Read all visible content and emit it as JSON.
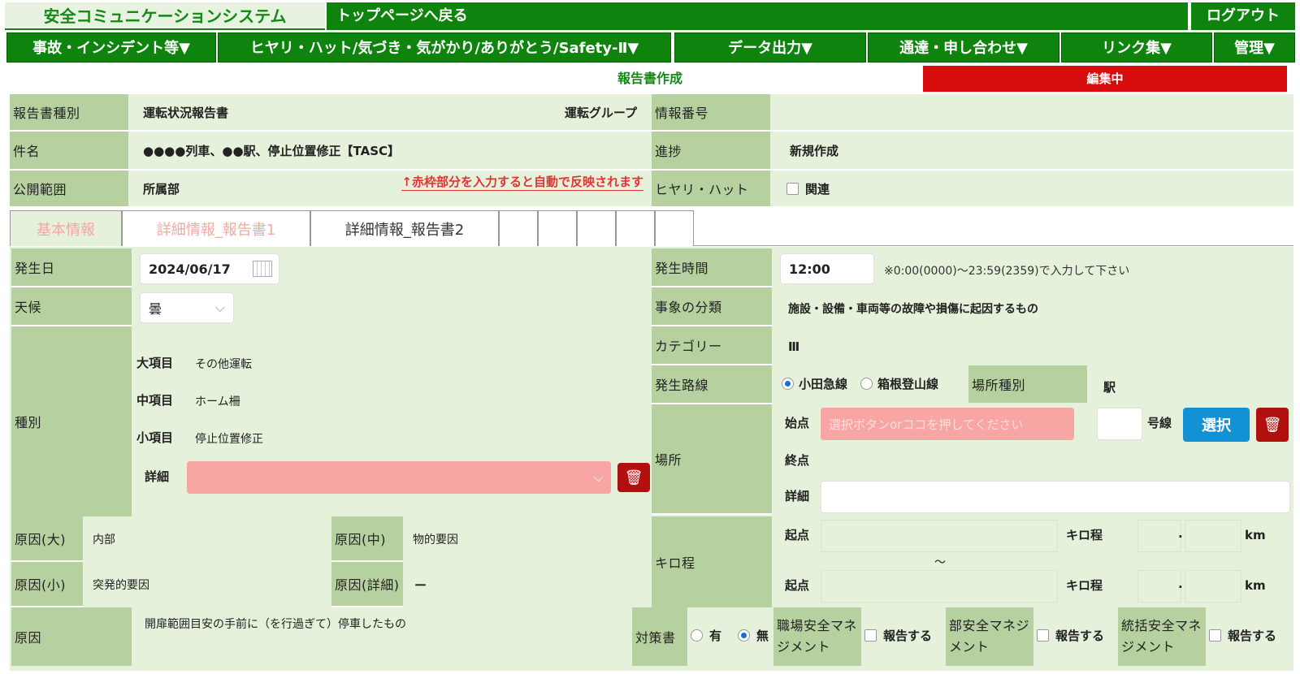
{
  "header": {
    "system_name": "安全コミュニケーションシステム",
    "back_to_top": "トップページへ戻る",
    "logout": "ログアウト"
  },
  "menu": [
    "事故・インシデント等▼",
    "ヒヤリ・ハット/気づき・気がかり/ありがとう/Safety-Ⅱ▼",
    "データ出力▼",
    "通達・申し合わせ▼",
    "リンク集▼",
    "管理▼"
  ],
  "status": {
    "create": "報告書作成",
    "editing": "編集中"
  },
  "info": {
    "type_label": "報告書種別",
    "type_value": "運転状況報告書",
    "group_value": "運転グループ",
    "info_no_label": "情報番号",
    "info_no_value": "",
    "subject_label": "件名",
    "subject_value": "●●●●列車、●●駅、停止位置修正【TASC】",
    "progress_label": "進捗",
    "progress_value": "新規作成",
    "scope_label": "公開範囲",
    "scope_value": "所属部",
    "auto_note": "↑赤枠部分を入力すると自動で反映されます",
    "hiyari_label": "ヒヤリ・ハット",
    "hiyari_check": "関連"
  },
  "tabs": [
    "基本情報",
    "詳細情報_報告書1",
    "詳細情報_報告書2",
    "",
    "",
    "",
    "",
    ""
  ],
  "basic": {
    "date_label": "発生日",
    "date_value": "2024/06/17",
    "time_label": "発生時間",
    "time_value": "12:00",
    "time_note": "※0:00(0000)〜23:59(2359)で入力して下さい",
    "weather_label": "天候",
    "weather_value": "曇",
    "event_class_label": "事象の分類",
    "event_class_value": "施設・設備・車両等の故障や損傷に起因するもの",
    "category_label": "カテゴリー",
    "category_value": "Ⅲ",
    "kind_label": "種別",
    "major_label": "大項目",
    "major_value": "その他運転",
    "middle_label": "中項目",
    "middle_value": "ホーム柵",
    "minor_label": "小項目",
    "minor_value": "停止位置修正",
    "detail_label": "詳細",
    "route_label": "発生路線",
    "route_opt1": "小田急線",
    "route_opt2": "箱根登山線",
    "place_type_label": "場所種別",
    "place_type_value": "駅",
    "place_label": "場所",
    "start_label": "始点",
    "start_placeholder": "選択ボタンorココを押してください",
    "track_suffix": "号線",
    "select_button": "選択",
    "end_label": "終点",
    "place_detail_label": "詳細",
    "km_label": "キロ程",
    "km_start1": "起点",
    "km_unit_label": "キロ程",
    "km_dot": ".",
    "km_unit": "km",
    "km_tilde": "〜",
    "km_start2": "起点",
    "cause_large_label": "原因(大)",
    "cause_large_value": "内部",
    "cause_mid_label": "原因(中)",
    "cause_mid_value": "物的要因",
    "cause_small_label": "原因(小)",
    "cause_small_value": "突発的要因",
    "cause_detail_label": "原因(詳細)",
    "cause_detail_value": "ー",
    "cause_label": "原因",
    "cause_text": "開扉範囲目安の手前に（を行過ぎて）停車したもの",
    "measure_label": "対策書",
    "measure_yes": "有",
    "measure_no": "無",
    "workplace_mgmt": "職場安全マネジメント",
    "dept_mgmt": "部安全マネジメント",
    "total_mgmt": "統括安全マネジメント",
    "report_check": "報告する"
  }
}
